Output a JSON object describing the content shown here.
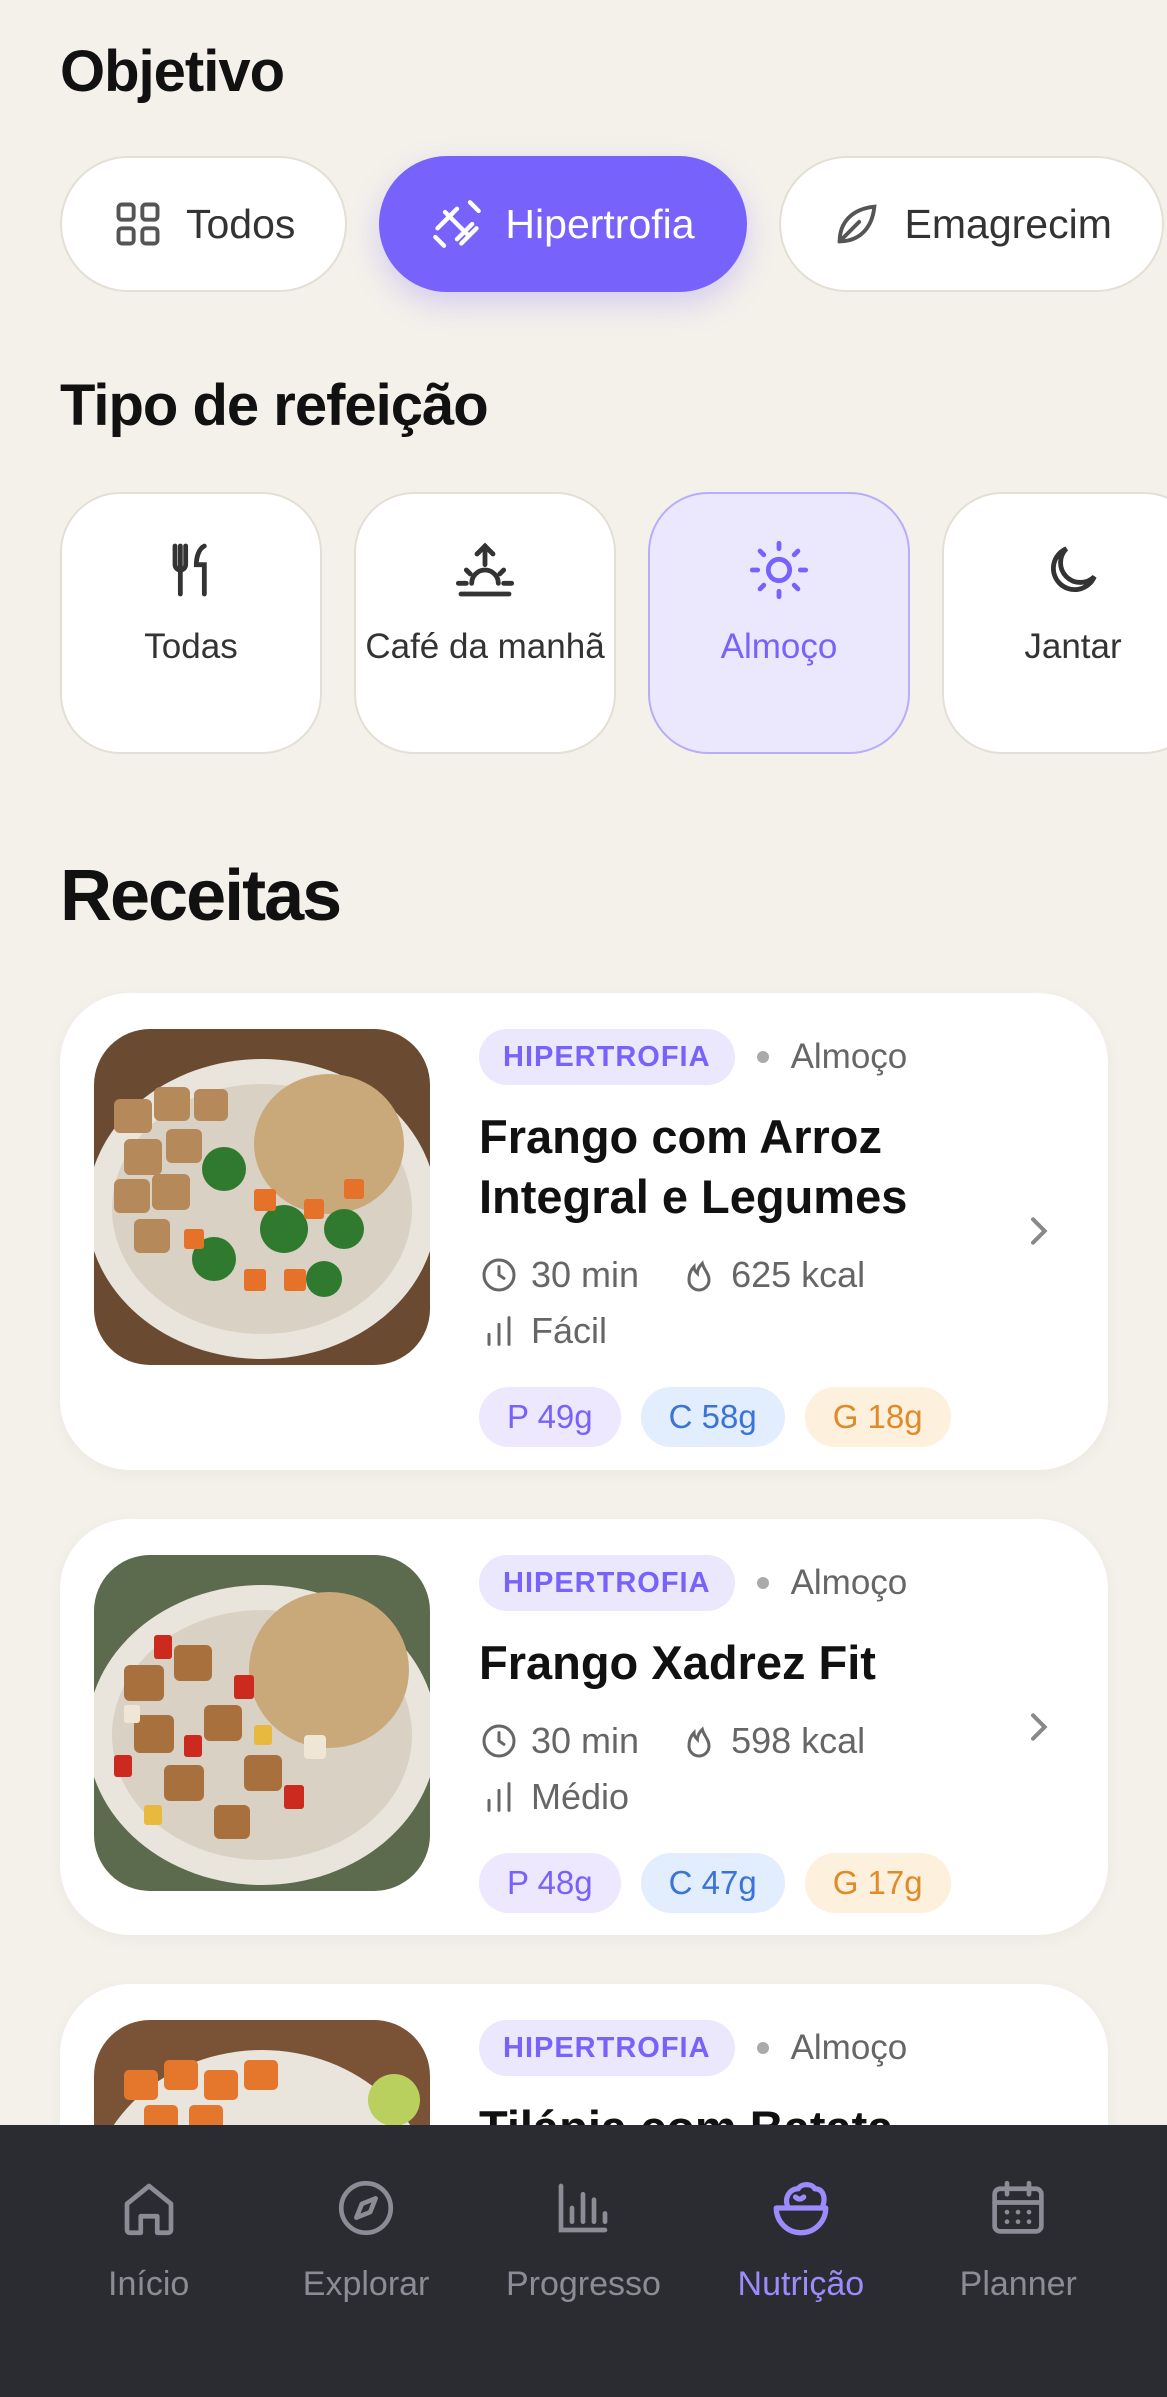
{
  "objective": {
    "title": "Objetivo",
    "chips": [
      {
        "label": "Todos",
        "icon": "grid-icon",
        "active": false
      },
      {
        "label": "Hipertrofia",
        "icon": "dumbbell-icon",
        "active": true
      },
      {
        "label": "Emagrecim",
        "icon": "leaf-icon",
        "active": false
      }
    ]
  },
  "meal_type": {
    "title": "Tipo de refeição",
    "items": [
      {
        "label": "Todas",
        "icon": "utensils-icon",
        "active": false
      },
      {
        "label": "Café da manhã",
        "icon": "sunrise-icon",
        "active": false
      },
      {
        "label": "Almoço",
        "icon": "sun-icon",
        "active": true
      },
      {
        "label": "Jantar",
        "icon": "moon-icon",
        "active": false
      }
    ]
  },
  "recipes": {
    "title": "Receitas",
    "items": [
      {
        "tag": "HIPERTROFIA",
        "meal": "Almoço",
        "title": "Frango com Arroz Integral e Legumes",
        "time": "30 min",
        "kcal": "625 kcal",
        "difficulty": "Fácil",
        "protein": "P 49g",
        "carbs": "C 58g",
        "fat": "G 18g"
      },
      {
        "tag": "HIPERTROFIA",
        "meal": "Almoço",
        "title": "Frango Xadrez Fit",
        "time": "30 min",
        "kcal": "598 kcal",
        "difficulty": "Médio",
        "protein": "P 48g",
        "carbs": "C 47g",
        "fat": "G 17g"
      },
      {
        "tag": "HIPERTROFIA",
        "meal": "Almoço",
        "title": "Tilápia com Batata"
      }
    ]
  },
  "nav": {
    "items": [
      {
        "label": "Início",
        "icon": "home-icon",
        "active": false
      },
      {
        "label": "Explorar",
        "icon": "compass-icon",
        "active": false
      },
      {
        "label": "Progresso",
        "icon": "bar-chart-icon",
        "active": false
      },
      {
        "label": "Nutrição",
        "icon": "salad-bowl-icon",
        "active": true
      },
      {
        "label": "Planner",
        "icon": "calendar-icon",
        "active": false
      }
    ]
  },
  "colors": {
    "accent": "#7763fb",
    "background": "#f4f1eb",
    "nav_bg": "#2b2c31"
  }
}
